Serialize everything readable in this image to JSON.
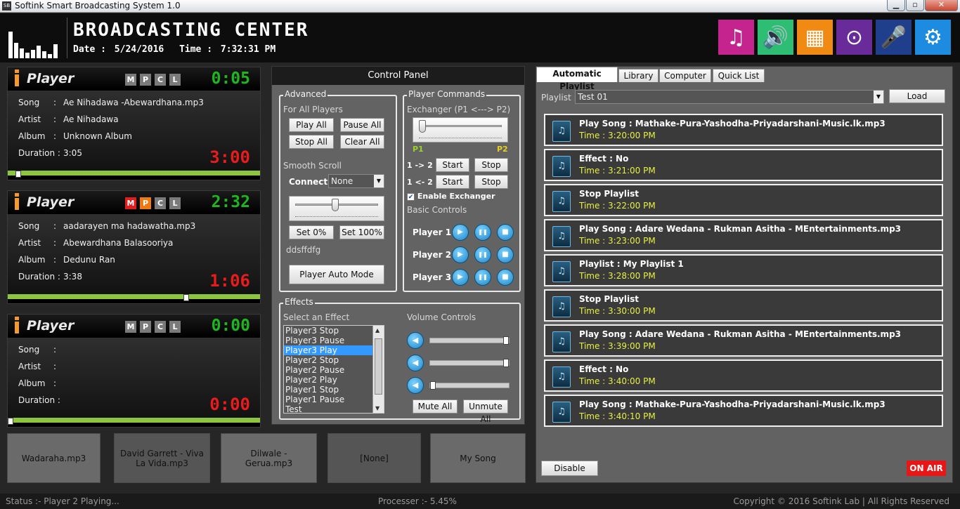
{
  "window": {
    "title": "Softink Smart Broadcasting System 1.0",
    "app_icon": "SB"
  },
  "header": {
    "brand": "BROADCASTING CENTER",
    "date_label": "Date :",
    "date_value": "5/24/2016",
    "time_label": "Time :",
    "time_value": "7:32:31 PM",
    "tiles": [
      {
        "icon": "music-note-icon",
        "color": "#c5248f",
        "glyph": "♫"
      },
      {
        "icon": "speaker-icon",
        "color": "#2dbd73",
        "glyph": "🔊"
      },
      {
        "icon": "blocks-icon",
        "color": "#f08a12",
        "glyph": "▦"
      },
      {
        "icon": "play-circle-icon",
        "color": "#6a2b9a",
        "glyph": "⊙"
      },
      {
        "icon": "microphone-icon",
        "color": "#1f3f8c",
        "glyph": "🎤"
      },
      {
        "icon": "settings-gear-icon",
        "color": "#1d8be0",
        "glyph": "⚙"
      }
    ]
  },
  "players": [
    {
      "name": "Player",
      "elapsed": "0:05",
      "remaining": "3:00",
      "song_label": "Song",
      "song": "Ae Nihadawa -Abewardhana.mp3",
      "artist_label": "Artist",
      "artist": "Ae Nihadawa",
      "album_label": "Album",
      "album": "Unknown Album",
      "duration_label": "Duration :",
      "duration": "3:05",
      "progress": 0.03,
      "flags": [
        "M",
        "P",
        "C",
        "L"
      ]
    },
    {
      "name": "Player",
      "elapsed": "2:32",
      "remaining": "1:06",
      "song_label": "Song",
      "song": "aadarayen ma hadawatha.mp3",
      "artist_label": "Artist",
      "artist": "Abewardhana Balasooriya",
      "album_label": "Album",
      "album": "Dedunu Ran",
      "duration_label": "Duration :",
      "duration": "3:38",
      "progress": 0.71,
      "flags": [
        "M",
        "P",
        "C",
        "L"
      ]
    },
    {
      "name": "Player",
      "elapsed": "0:00",
      "remaining": "0:00",
      "song_label": "Song",
      "song": "",
      "artist_label": "Artist",
      "artist": "",
      "album_label": "Album",
      "album": "",
      "duration_label": "Duration :",
      "duration": "",
      "progress": 0.0,
      "flags": [
        "M",
        "P",
        "C",
        "L"
      ]
    }
  ],
  "quick_buttons": [
    "Wadaraha.mp3",
    "David Garrett - Viva La Vida.mp3",
    "Dilwale - Gerua.mp3",
    "[None]",
    "My Song"
  ],
  "control_panel": {
    "title": "Control Panel",
    "advanced": {
      "legend": "Advanced",
      "for_all_players": "For All Players",
      "play_all": "Play All",
      "pause_all": "Pause All",
      "stop_all": "Stop All",
      "clear_all": "Clear All",
      "smooth_scroll": "Smooth Scroll",
      "connect_label": "Connect",
      "connect_value": "None",
      "set_0": "Set 0%",
      "set_100": "Set 100%",
      "note": "ddsffdfg",
      "auto_mode": "Player Auto Mode"
    },
    "player_commands": {
      "legend": "Player Commands",
      "exchanger": "Exchanger (P1 <---> P2)",
      "p1": "P1",
      "p2": "P2",
      "row1_label": "1 -> 2",
      "row2_label": "1 <- 2",
      "start": "Start",
      "stop": "Stop",
      "enable_exchanger": "Enable Exchanger",
      "basic_controls": "Basic Controls",
      "player_rows": [
        "Player 1",
        "Player 2",
        "Player 3"
      ]
    },
    "effects": {
      "legend": "Effects",
      "select_label": "Select an Effect",
      "items": [
        "Player3 Stop",
        "Player3 Pause",
        "Player3 Play",
        "Player2 Stop",
        "Player2 Pause",
        "Player2 Play",
        "Player1 Stop",
        "Player1 Pause",
        "Test"
      ],
      "selected": "Player3 Play",
      "volume_label": "Volume Controls",
      "volumes": [
        1.0,
        1.0,
        0.0
      ],
      "mute_all": "Mute All",
      "unmute_all": "Unmute All"
    }
  },
  "right_panel": {
    "tabs": [
      "Automatic Playlist",
      "Library",
      "Computer",
      "Quick List"
    ],
    "active_tab": "Automatic Playlist",
    "playlist_label": "Playlist :",
    "playlist_value": "Test 01",
    "load": "Load",
    "items": [
      {
        "title": "Play Song : Mathake-Pura-Yashodha-Priyadarshani-Music.lk.mp3",
        "time": "Time : 3:20:00 PM"
      },
      {
        "title": "Effect : No",
        "time": "Time : 3:21:00 PM"
      },
      {
        "title": "Stop Playlist",
        "time": "Time : 3:22:00 PM"
      },
      {
        "title": "Play Song : Adare Wedana - Rukman Asitha - MEntertainments.mp3",
        "time": "Time : 3:23:00 PM"
      },
      {
        "title": "Playlist : My Playlist 1",
        "time": "Time : 3:28:00 PM"
      },
      {
        "title": "Stop Playlist",
        "time": "Time : 3:30:00 PM"
      },
      {
        "title": "Play Song : Adare Wedana - Rukman Asitha - MEntertainments.mp3",
        "time": "Time : 3:39:00 PM"
      },
      {
        "title": "Effect : No",
        "time": "Time : 3:40:00 PM"
      },
      {
        "title": "Play Song : Mathake-Pura-Yashodha-Priyadarshani-Music.lk.mp3",
        "time": "Time : 3:40:10 PM"
      }
    ],
    "disable": "Disable",
    "on_air": "ON AIR"
  },
  "status": {
    "left": "Status :- Player 2 Playing...",
    "center": "Processer :- 5.45%",
    "right": "Copyright © 2016 Softink Lab | All Rights Reserved"
  }
}
